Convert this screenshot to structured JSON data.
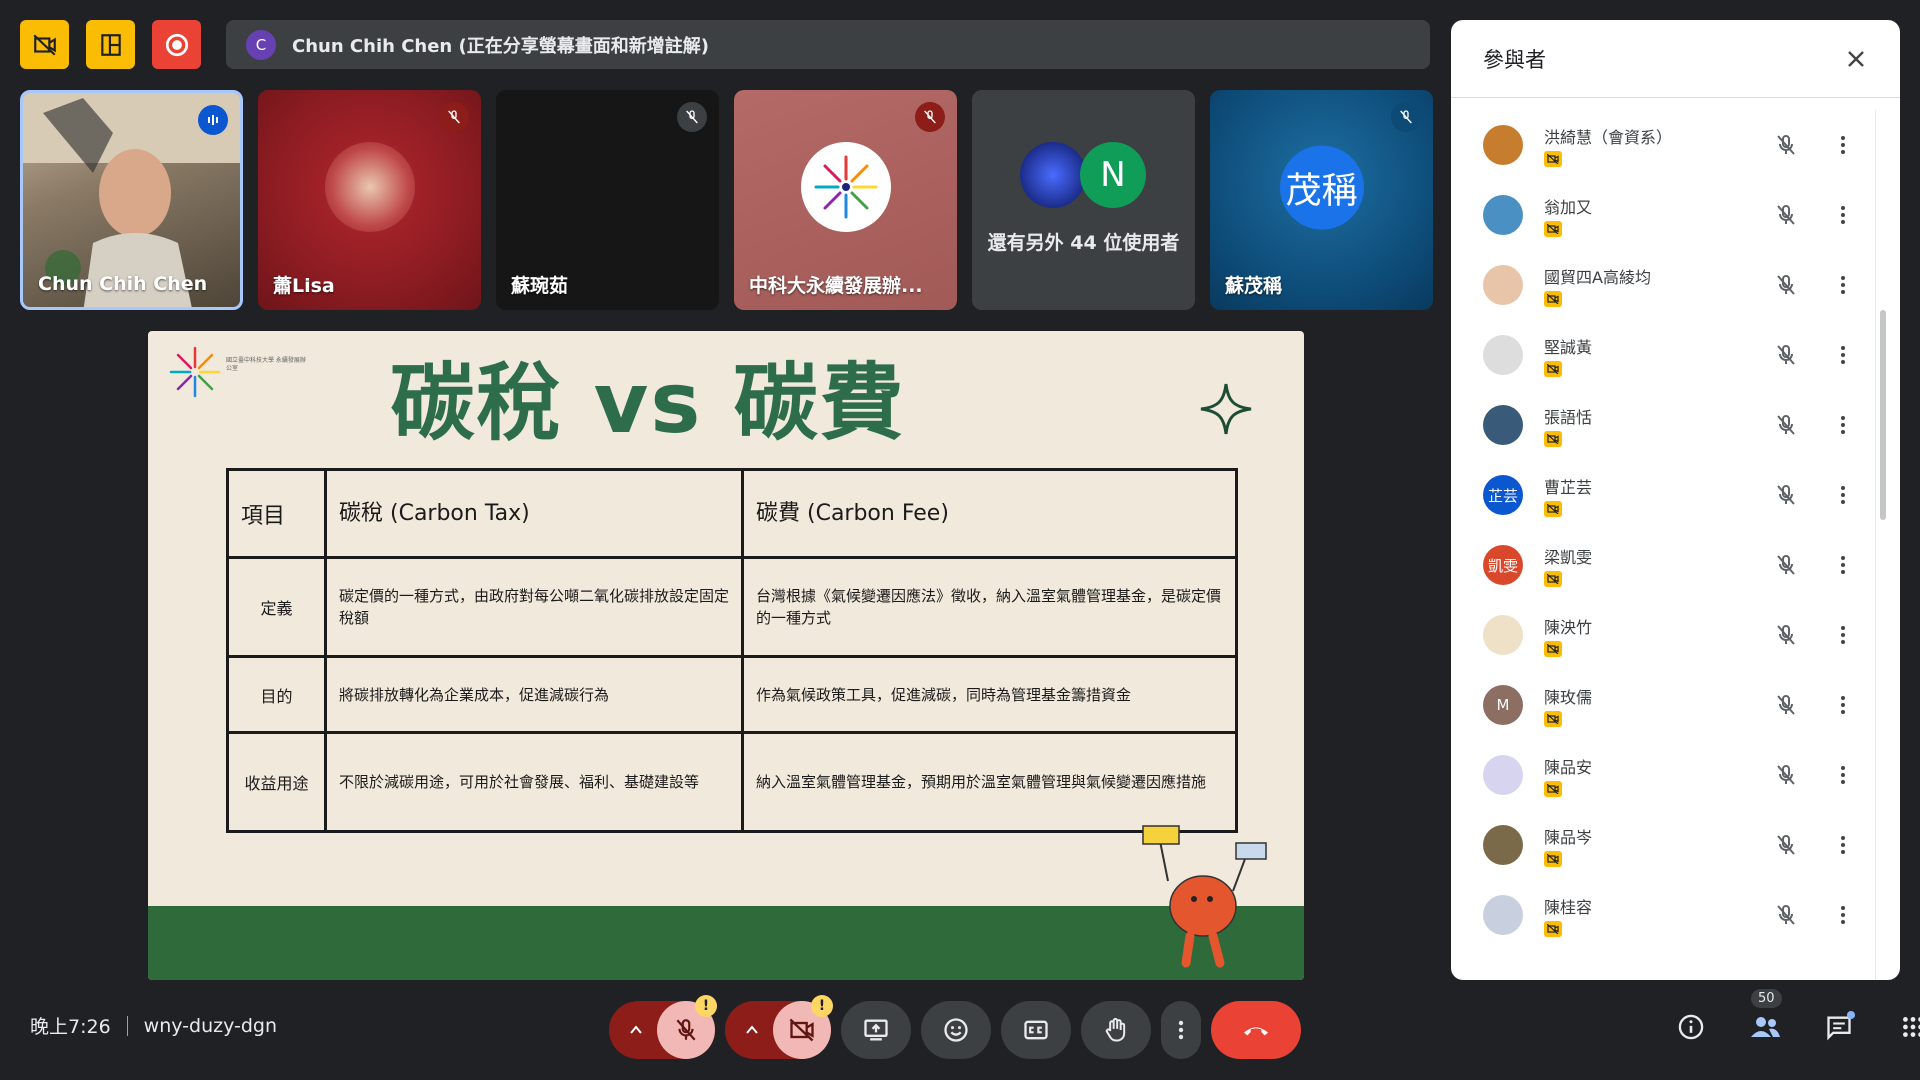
{
  "presenter_bar": {
    "avatar_letter": "C",
    "text": "Chun Chih Chen (正在分享螢幕畫面和新增註解)"
  },
  "tiles": [
    {
      "name": "Chun Chih Chen"
    },
    {
      "name": "蕭Lisa"
    },
    {
      "name": "蘇琬茹"
    },
    {
      "name": "中科大永續發展辦..."
    },
    {
      "name": "還有另外 44 位使用者",
      "avatar_letter": "N"
    },
    {
      "name": "蘇茂稱",
      "avatar_text": "茂稱"
    }
  ],
  "slide": {
    "title": "碳稅 vs 碳費",
    "logo_text": "國立臺中科技大學 永續發展辦公室",
    "table": {
      "headers": [
        "項目",
        "碳稅 (Carbon Tax)",
        "碳費 (Carbon Fee)"
      ],
      "rows": [
        [
          "定義",
          "碳定價的一種方式，由政府對每公噸二氧化碳排放設定固定稅額",
          "台灣根據《氣候變遷因應法》徵收，納入溫室氣體管理基金，是碳定價的一種方式"
        ],
        [
          "目的",
          "將碳排放轉化為企業成本，促進減碳行為",
          "作為氣候政策工具，促進減碳，同時為管理基金籌措資金"
        ],
        [
          "收益用途",
          "不限於減碳用途，可用於社會發展、福利、基礎建設等",
          "納入溫室氣體管理基金，預期用於溫室氣體管理與氣候變遷因應措施"
        ]
      ]
    }
  },
  "panel": {
    "title": "參與者",
    "participants": [
      {
        "name": "洪綺慧（會資系）",
        "avatar_color": "#c77d2e"
      },
      {
        "name": "翁加又",
        "avatar_color": "#4a90c2"
      },
      {
        "name": "國貿四A高綾均",
        "avatar_color": "#e8c4a8"
      },
      {
        "name": "堅誠黃",
        "avatar_color": "#dddddd"
      },
      {
        "name": "張語恬",
        "avatar_color": "#3a5a7a"
      },
      {
        "name": "曹芷芸",
        "avatar_color": "#0b57d0",
        "avatar_text": "芷芸"
      },
      {
        "name": "梁凱雯",
        "avatar_color": "#d9482b",
        "avatar_text": "凱雯"
      },
      {
        "name": "陳泱竹",
        "avatar_color": "#efe0c8"
      },
      {
        "name": "陳玫儒",
        "avatar_color": "#8d6e63",
        "avatar_text": "M"
      },
      {
        "name": "陳品安",
        "avatar_color": "#d7d4f0"
      },
      {
        "name": "陳品岑",
        "avatar_color": "#7a6a4a"
      },
      {
        "name": "陳桂容",
        "avatar_color": "#c8d0e0"
      }
    ]
  },
  "bottom": {
    "time": "晚上7:26",
    "meeting_code": "wny-duzy-dgn",
    "participant_count": "50",
    "warn_symbol": "!"
  },
  "colors": {
    "accent_yellow": "#fbbc04",
    "accent_red": "#ea4335",
    "slide_green": "#2d6d4c",
    "muted_red_bg": "#8c1d18"
  }
}
